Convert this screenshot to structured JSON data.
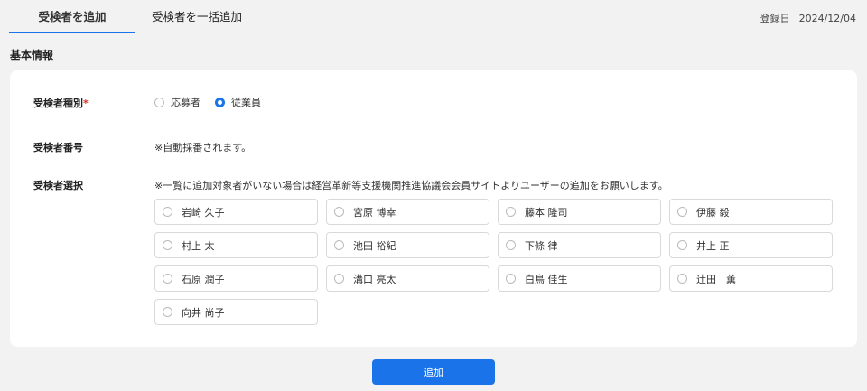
{
  "tabs": [
    {
      "label": "受検者を追加",
      "active": true
    },
    {
      "label": "受検者を一括追加",
      "active": false
    }
  ],
  "registration": {
    "label": "登録日",
    "date": "2024/12/04"
  },
  "section_title": "基本情報",
  "fields": {
    "type": {
      "label": "受検者種別",
      "required_mark": "*",
      "options": [
        {
          "label": "応募者",
          "selected": false
        },
        {
          "label": "従業員",
          "selected": true
        }
      ]
    },
    "number": {
      "label": "受検者番号",
      "value": "※自動採番されます。"
    },
    "selection": {
      "label": "受検者選択",
      "note": "※一覧に追加対象者がいない場合は経営革新等支援機関推進協議会会員サイトよりユーザーの追加をお願いします。",
      "candidates": [
        "岩崎 久子",
        "宮原 博幸",
        "藤本 隆司",
        "伊藤 毅",
        "村上 太",
        "池田 裕紀",
        "下條 律",
        "井上 正",
        "石原 潤子",
        "溝口 亮太",
        "白鳥 佳生",
        "辻田　薫",
        "向井 尚子"
      ]
    }
  },
  "add_button": {
    "label": "追加"
  },
  "colors": {
    "accent": "#1a73e8",
    "required": "#d93025",
    "background": "#f2f2f3"
  }
}
